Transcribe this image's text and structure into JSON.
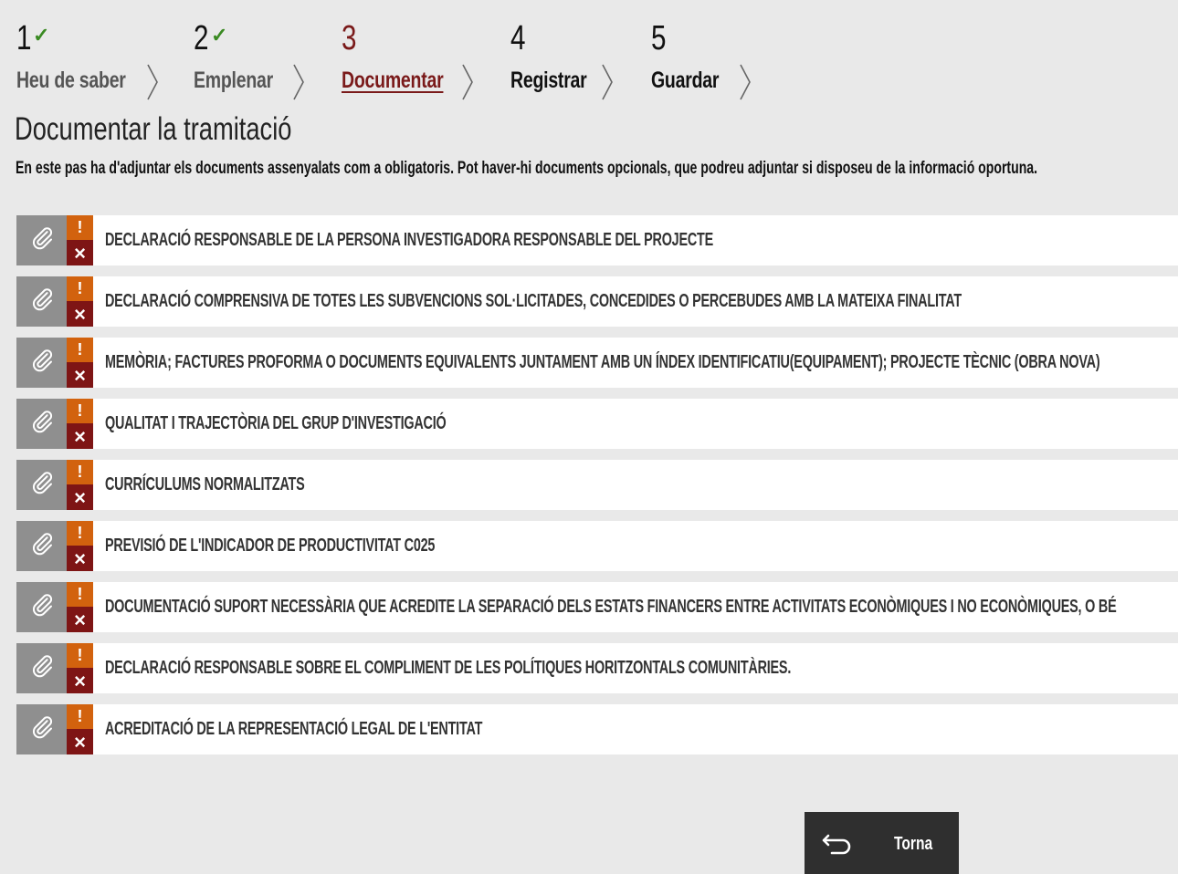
{
  "wizard": {
    "steps": [
      {
        "number": "1",
        "label": "Heu de saber",
        "state": "done"
      },
      {
        "number": "2",
        "label": "Emplenar",
        "state": "done"
      },
      {
        "number": "3",
        "label": "Documentar",
        "state": "active"
      },
      {
        "number": "4",
        "label": "Registrar",
        "state": "pending"
      },
      {
        "number": "5",
        "label": "Guardar",
        "state": "pending"
      }
    ],
    "check_icon": "✓"
  },
  "page": {
    "title": "Documentar la tramitació",
    "description": "En este pas ha d'adjuntar els documents assenyalats com a obligatoris. Pot haver-hi documents opcionals, que podreu adjuntar si disposeu de la informació oportuna."
  },
  "documents": [
    "DECLARACIÓ RESPONSABLE DE LA PERSONA INVESTIGADORA RESPONSABLE DEL PROJECTE",
    "DECLARACIÓ COMPRENSIVA DE TOTES LES SUBVENCIONS SOL·LICITADES, CONCEDIDES O PERCEBUDES AMB LA MATEIXA FINALITAT",
    "MEMÒRIA; FACTURES PROFORMA O DOCUMENTS EQUIVALENTS JUNTAMENT AMB UN ÍNDEX IDENTIFICATIU(EQUIPAMENT); PROJECTE TÈCNIC (OBRA NOVA)",
    "QUALITAT I TRAJECTÒRIA DEL GRUP D'INVESTIGACIÓ",
    "CURRÍCULUMS NORMALITZATS",
    "PREVISIÓ DE L'INDICADOR DE PRODUCTIVITAT C025",
    "DOCUMENTACIÓ SUPORT NECESSÀRIA QUE ACREDITE LA SEPARACIÓ DELS ESTATS FINANCERS ENTRE ACTIVITATS ECONÒMIQUES I NO ECONÒMIQUES, O BÉ",
    "DECLARACIÓ RESPONSABLE SOBRE EL COMPLIMENT DE LES POLÍTIQUES HORITZONTALS COMUNITÀRIES.",
    "ACREDITACIÓ DE LA REPRESENTACIÓ LEGAL DE L'ENTITAT"
  ],
  "status_icons": {
    "warning": "!",
    "missing": "×"
  },
  "icons": {
    "attach": "paperclip-icon",
    "back": "return-arrow-icon"
  },
  "colors": {
    "active_step": "#7a1a1a",
    "done_check": "#3a8a22",
    "warning": "#d2620e",
    "missing": "#7e1515",
    "attach_bg": "#8f8f8f",
    "back_button_bg": "#2f2f2f"
  },
  "actions": {
    "back_label": "Torna"
  }
}
